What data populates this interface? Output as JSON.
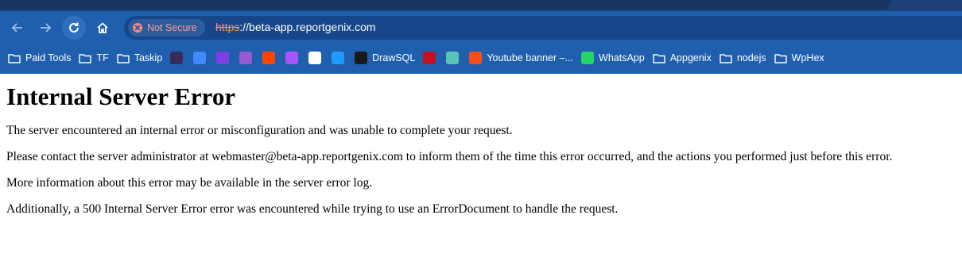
{
  "browser": {
    "security_label": "Not Secure",
    "url_scheme": "https",
    "url_rest": "://beta-app.reportgenix.com",
    "bookmarks": [
      {
        "type": "folder",
        "label": "Paid Tools"
      },
      {
        "type": "folder",
        "label": "TF"
      },
      {
        "type": "folder",
        "label": "Taskip"
      },
      {
        "type": "favicon",
        "label": "",
        "color": "#3a2a5a"
      },
      {
        "type": "favicon",
        "label": "",
        "color": "#3d8bff"
      },
      {
        "type": "favicon",
        "label": "",
        "color": "#7b3fe4"
      },
      {
        "type": "favicon",
        "label": "",
        "color": "#9b59d0"
      },
      {
        "type": "favicon",
        "label": "",
        "color": "#ff4500"
      },
      {
        "type": "favicon",
        "label": "",
        "color": "#a855f7"
      },
      {
        "type": "favicon",
        "label": "",
        "color": "#ffffff"
      },
      {
        "type": "favicon",
        "label": "",
        "color": "#1e9bff"
      },
      {
        "type": "favicon-text",
        "label": "DrawSQL",
        "color": "#1a1a1a"
      },
      {
        "type": "favicon",
        "label": "",
        "color": "#c0121f"
      },
      {
        "type": "favicon",
        "label": "",
        "color": "#5bc2b8"
      },
      {
        "type": "favicon-text",
        "label": "Youtube banner –...",
        "color": "#f24e1e"
      },
      {
        "type": "favicon-text",
        "label": "WhatsApp",
        "color": "#25d366"
      },
      {
        "type": "folder",
        "label": "Appgenix"
      },
      {
        "type": "folder",
        "label": "nodejs"
      },
      {
        "type": "folder",
        "label": "WpHex"
      }
    ]
  },
  "page": {
    "title": "Internal Server Error",
    "paragraphs": [
      "The server encountered an internal error or misconfiguration and was unable to complete your request.",
      "Please contact the server administrator at webmaster@beta-app.reportgenix.com to inform them of the time this error occurred, and the actions you performed just before this error.",
      "More information about this error may be available in the server error log.",
      "Additionally, a 500 Internal Server Error error was encountered while trying to use an ErrorDocument to handle the request."
    ]
  }
}
